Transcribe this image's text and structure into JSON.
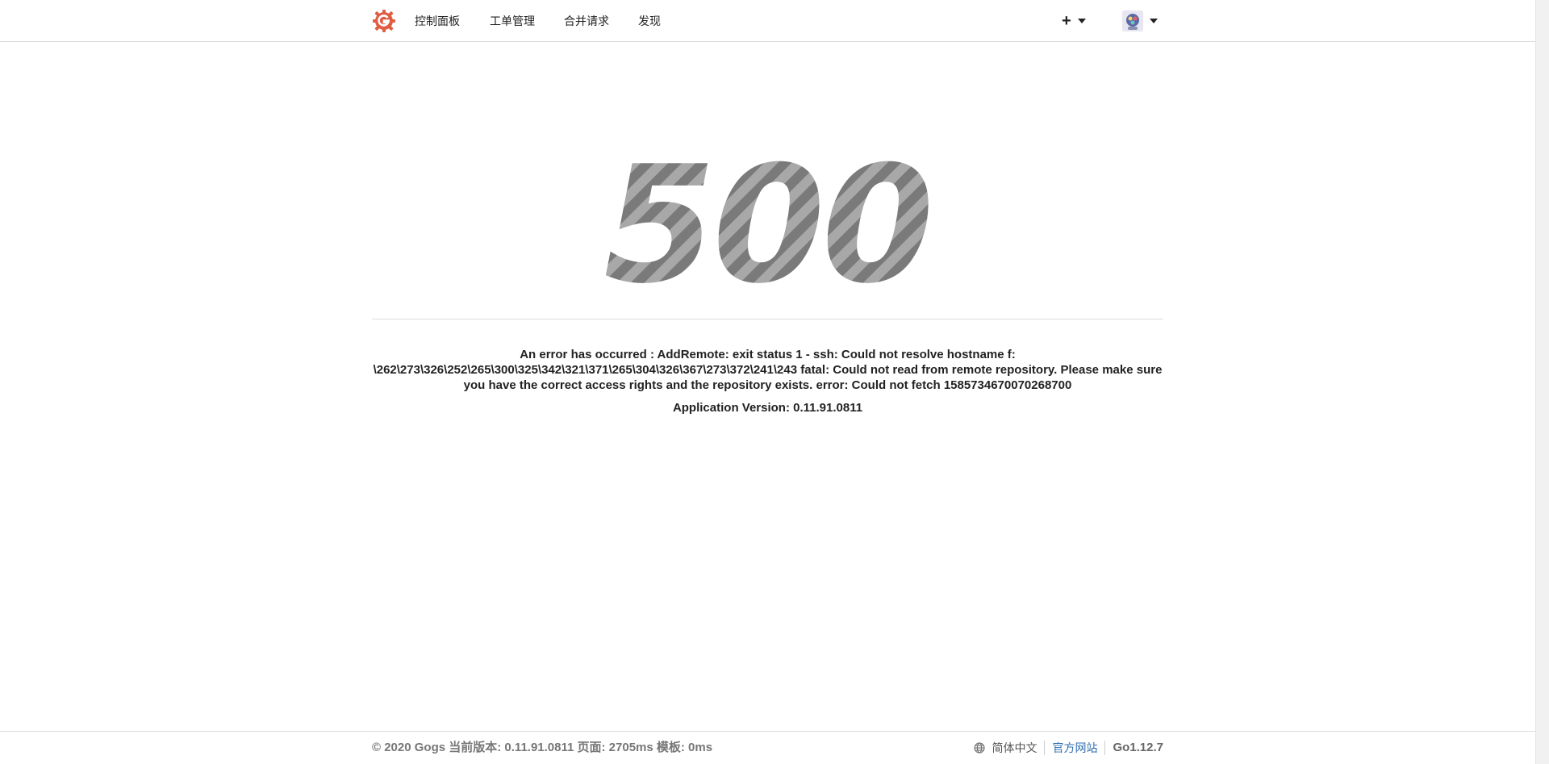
{
  "nav": {
    "items": [
      {
        "label": "控制面板"
      },
      {
        "label": "工单管理"
      },
      {
        "label": "合并请求"
      },
      {
        "label": "发现"
      }
    ],
    "create_icon": "plus-icon",
    "avatar_icon": "avatar-icon"
  },
  "error": {
    "code": "500",
    "message": "An error has occurred : AddRemote: exit status 1 - ssh: Could not resolve hostname f: \\262\\273\\326\\252\\265\\300\\325\\342\\321\\371\\265\\304\\326\\367\\273\\372\\241\\243 fatal: Could not read from remote repository. Please make sure you have the correct access rights and the repository exists. error: Could not fetch 1585734670070268700",
    "app_version": "Application Version: 0.11.91.0811"
  },
  "footer": {
    "copyright": "© 2020 Gogs 当前版本: 0.11.91.0811 页面: 2705ms 模板: 0ms",
    "language": "简体中文",
    "official_site": "官方网站",
    "go_version": "Go1.12.7"
  },
  "colors": {
    "logo": "#e05d44",
    "link": "#2f6db0",
    "code_stripe_dark": "#7a7a7a",
    "code_stripe_light": "#a8a8a8"
  }
}
